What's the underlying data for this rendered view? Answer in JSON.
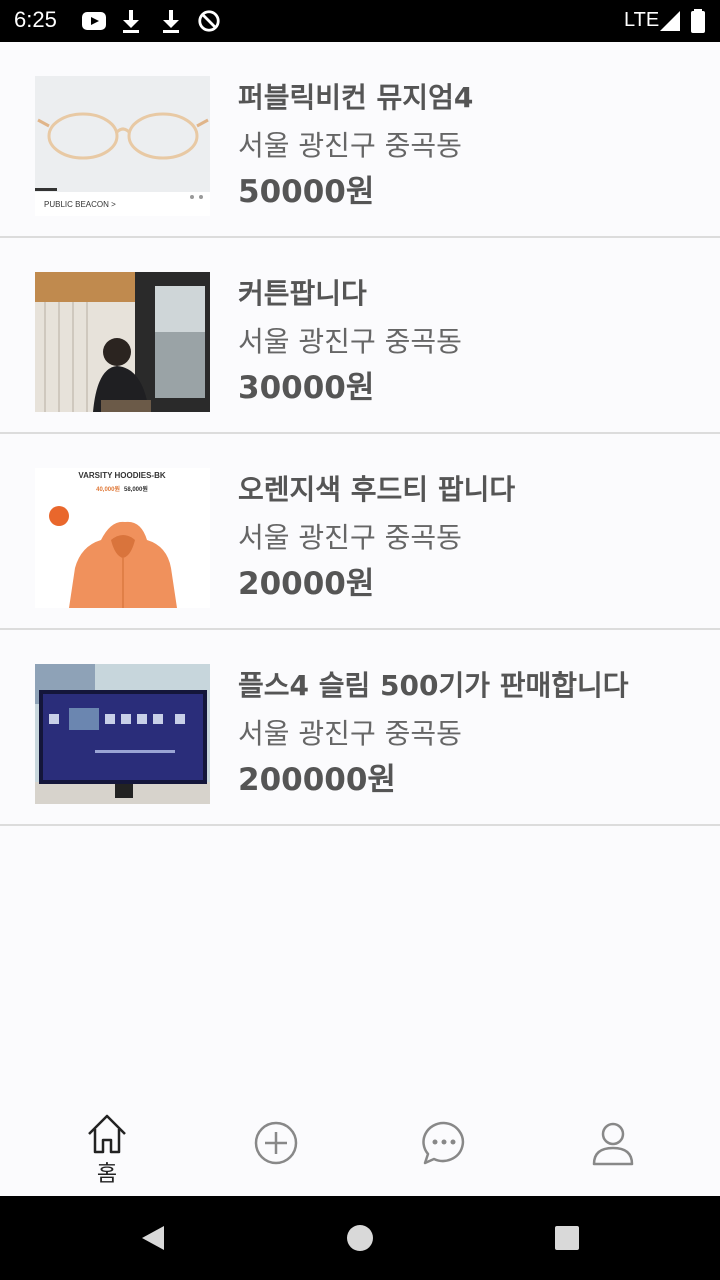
{
  "status_bar": {
    "time": "6:25",
    "network": "LTE"
  },
  "listings": [
    {
      "title": "퍼블릭비컨 뮤지엄4",
      "location": "서울 광진구 중곡동",
      "price": "50000원",
      "thumb_caption": "PUBLIC BEACON >"
    },
    {
      "title": "커튼팝니다",
      "location": "서울 광진구 중곡동",
      "price": "30000원"
    },
    {
      "title": "오렌지색 후드티 팝니다",
      "location": "서울 광진구 중곡동",
      "price": "20000원",
      "thumb_caption": "VARSITY HOODIES-BK",
      "thumb_price_sale": "40,000원",
      "thumb_price_orig": "58,000원"
    },
    {
      "title": "플스4 슬림 500기가 판매합니다",
      "location": "서울 광진구 중곡동",
      "price": "200000원"
    }
  ],
  "tab_bar": {
    "home_label": "홈"
  },
  "colors": {
    "accent_orange": "#f07a45",
    "text": "#555555",
    "divider": "#dcdcdc"
  }
}
